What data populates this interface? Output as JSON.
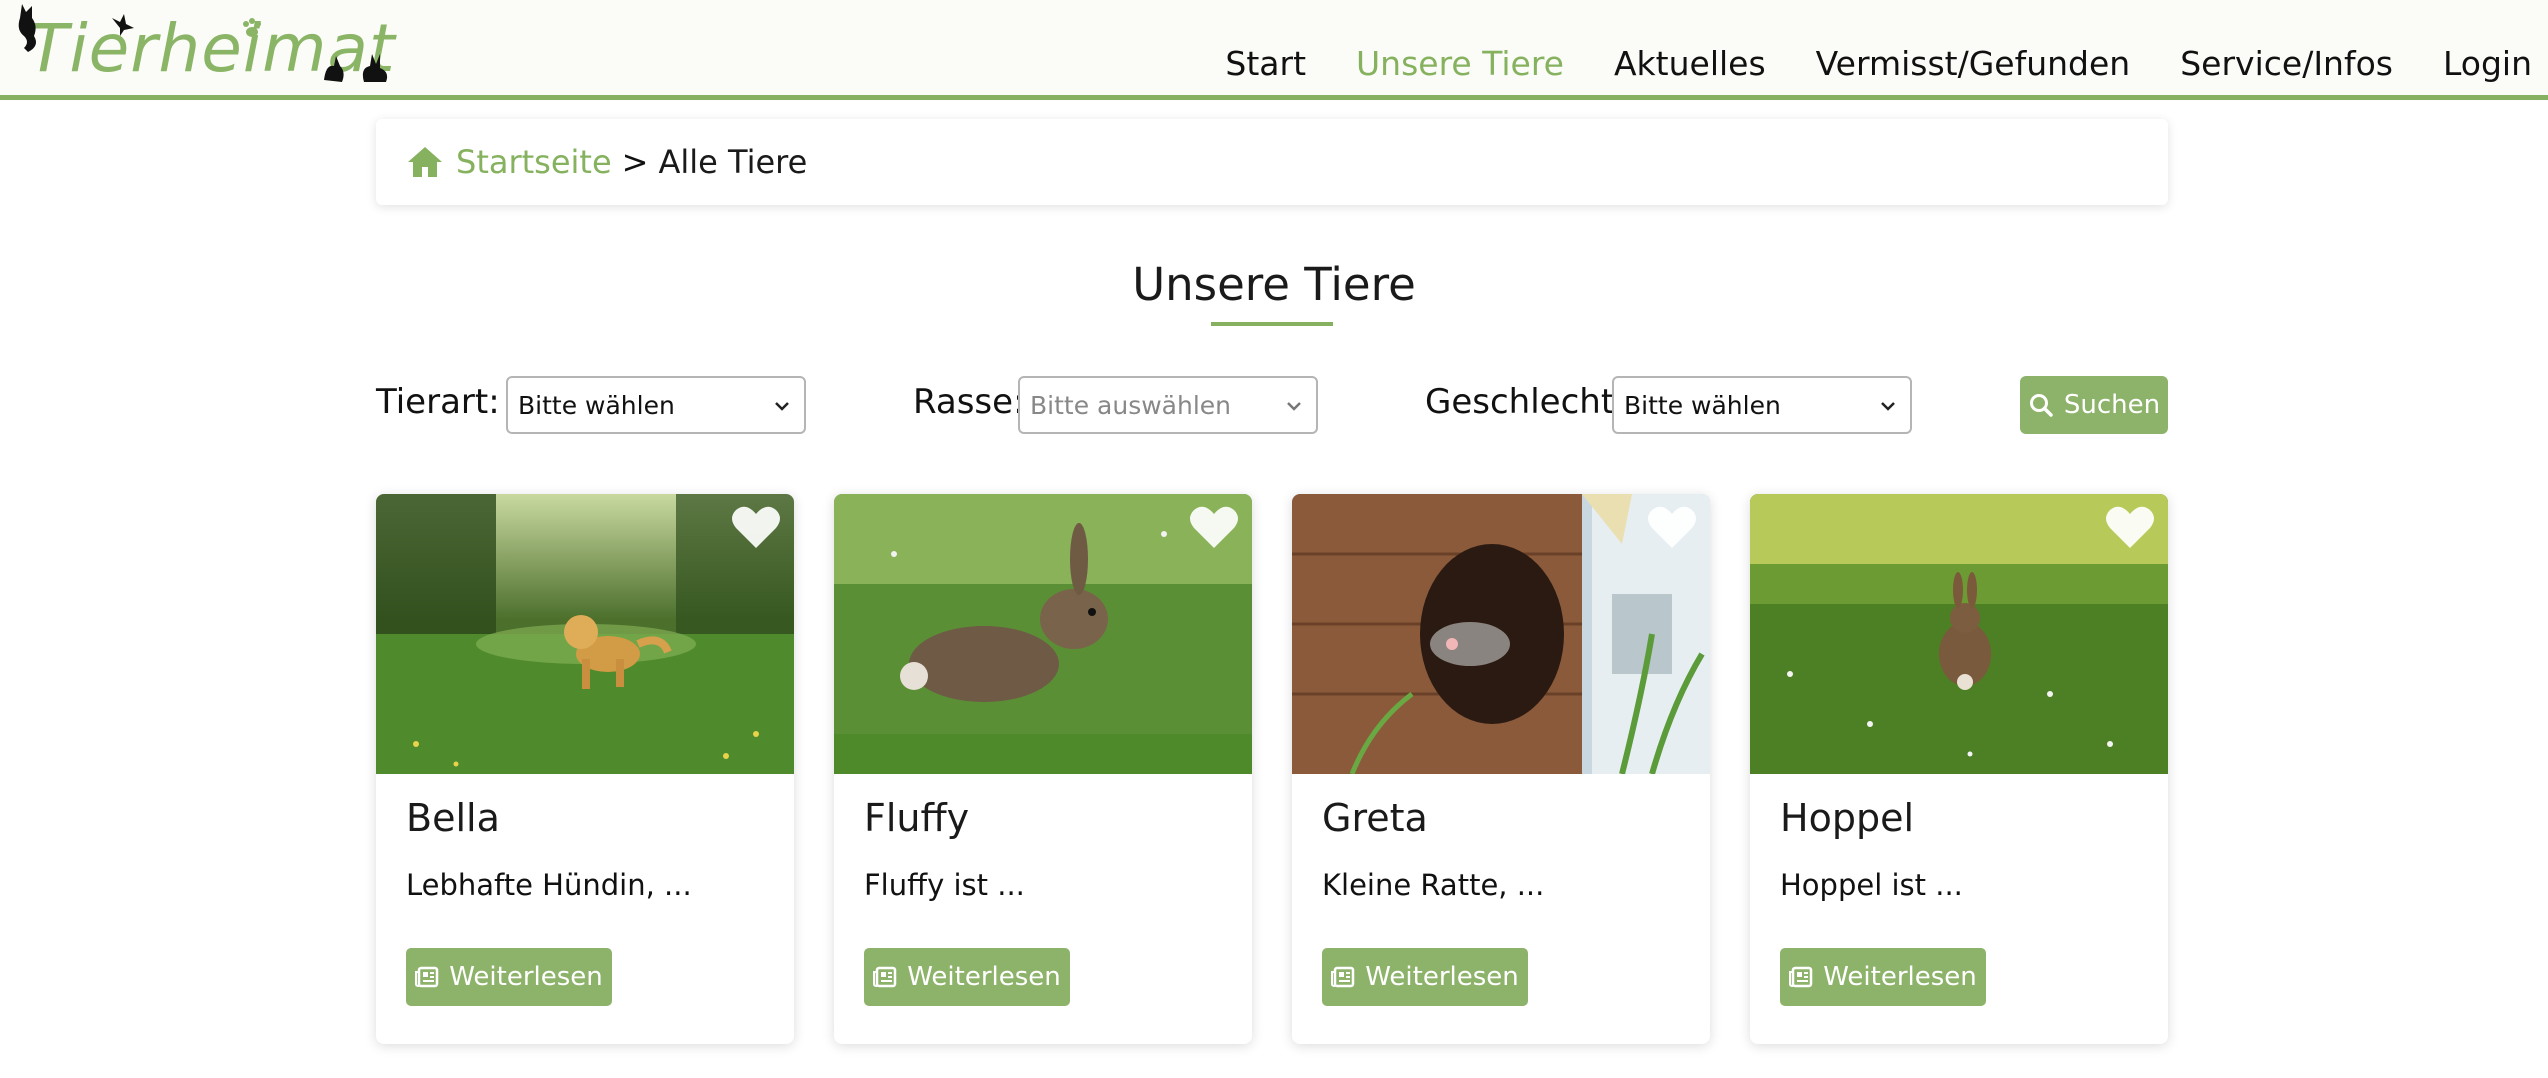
{
  "header": {
    "logo_text": "Tierheimat",
    "nav": [
      {
        "label": "Start",
        "active": false
      },
      {
        "label": "Unsere Tiere",
        "active": true
      },
      {
        "label": "Aktuelles",
        "active": false
      },
      {
        "label": "Vermisst/Gefunden",
        "active": false
      },
      {
        "label": "Service/Infos",
        "active": false
      },
      {
        "label": "Login",
        "active": false
      }
    ]
  },
  "breadcrumb": {
    "home_label": "Startseite",
    "separator": ">",
    "current": "Alle Tiere"
  },
  "page": {
    "title": "Unsere Tiere"
  },
  "filters": {
    "tierart_label": "Tierart:",
    "tierart_value": "Bitte wählen",
    "rasse_label": "Rasse:",
    "rasse_value": "Bitte auswählen",
    "geschlecht_label": "Geschlecht:",
    "geschlecht_value": "Bitte wählen",
    "search_label": "Suchen"
  },
  "cards": [
    {
      "name": "Bella",
      "description": "Lebhafte Hündin, ...",
      "button": "Weiterlesen",
      "image": "golden-retriever-in-meadow"
    },
    {
      "name": "Fluffy",
      "description": "Fluffy ist ...",
      "button": "Weiterlesen",
      "image": "rabbit-in-grass"
    },
    {
      "name": "Greta",
      "description": "Kleine Ratte, ...",
      "button": "Weiterlesen",
      "image": "rat-in-wooden-house"
    },
    {
      "name": "Hoppel",
      "description": "Hoppel ist ...",
      "button": "Weiterlesen",
      "image": "rabbit-on-lawn"
    }
  ],
  "colors": {
    "accent": "#86b25f",
    "button": "#8db36a",
    "header_bg": "#fbfcf7"
  }
}
